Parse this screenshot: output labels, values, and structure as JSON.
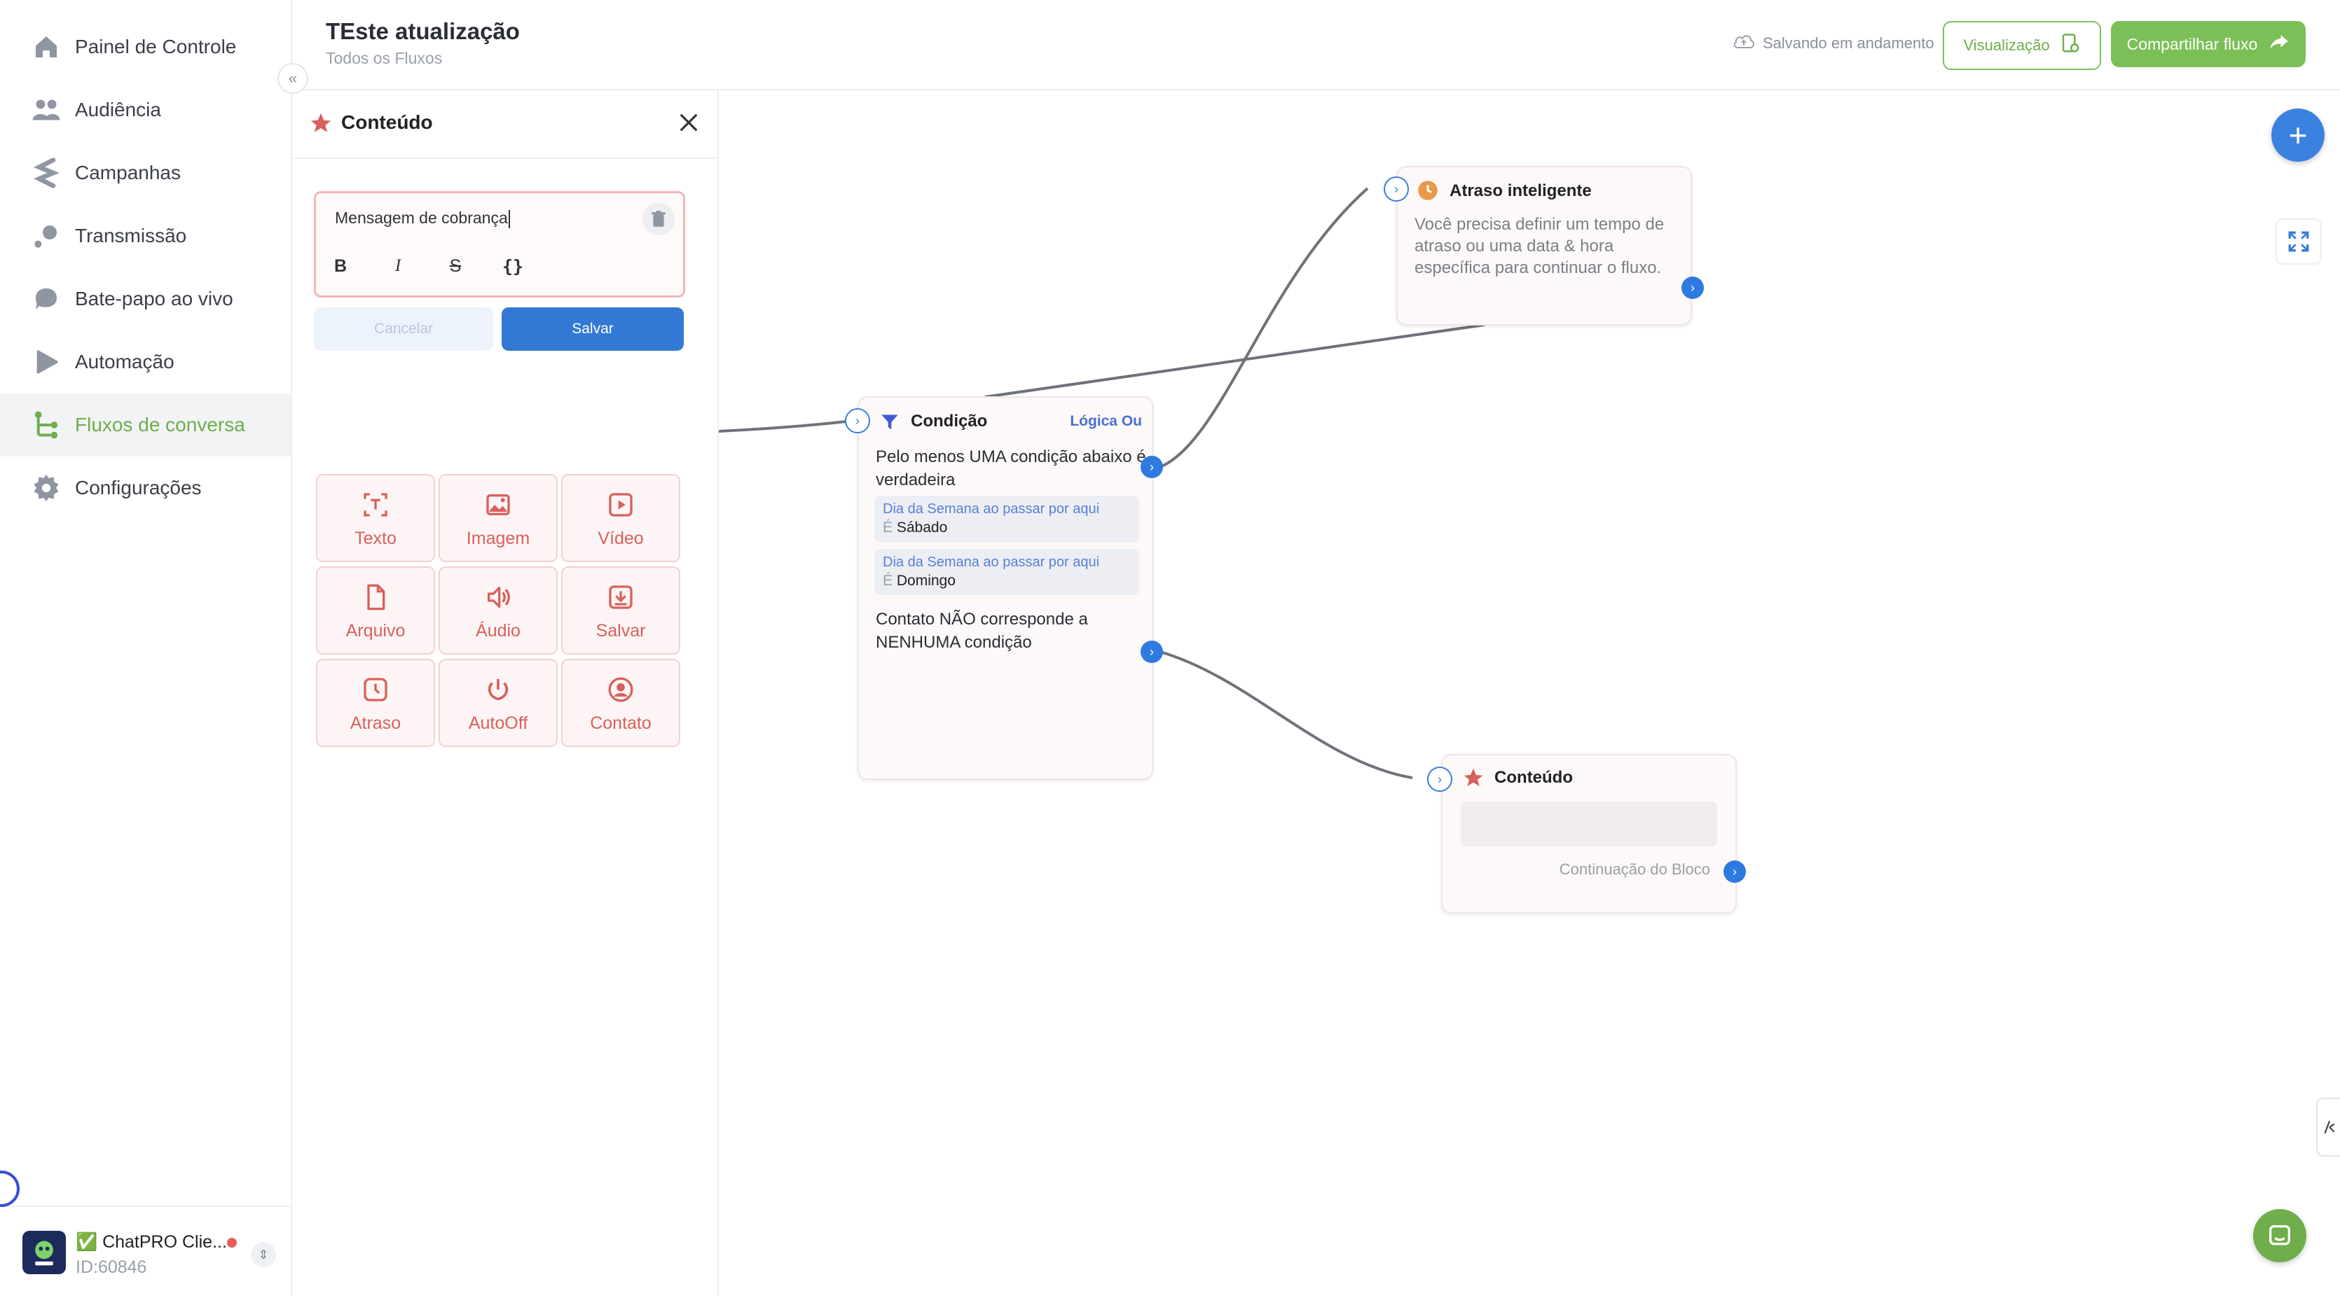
{
  "sidebar": {
    "items": [
      {
        "label": "Painel de Controle",
        "icon": "home-icon"
      },
      {
        "label": "Audiência",
        "icon": "users-icon"
      },
      {
        "label": "Campanhas",
        "icon": "campaign-icon"
      },
      {
        "label": "Transmissão",
        "icon": "broadcast-icon"
      },
      {
        "label": "Bate-papo ao vivo",
        "icon": "chat-bubble-icon"
      },
      {
        "label": "Automação",
        "icon": "play-icon"
      },
      {
        "label": "Fluxos de conversa",
        "icon": "flow-icon",
        "active": true
      },
      {
        "label": "Configurações",
        "icon": "gear-icon"
      }
    ],
    "account": {
      "name": "✅ ChatPRO Clie...",
      "id": "ID:60846"
    }
  },
  "header": {
    "title": "TEste atualização",
    "subtitle": "Todos os Fluxos",
    "saving_status": "Salvando em andamento",
    "preview_label": "Visualização",
    "share_label": "Compartilhar fluxo"
  },
  "panel": {
    "title": "Conteúdo",
    "editor": {
      "value": "Mensagem de cobrança",
      "format_buttons": [
        "B",
        "I",
        "S",
        "{}"
      ]
    },
    "cancel_label": "Cancelar",
    "save_label": "Salvar",
    "tiles": [
      {
        "label": "Texto",
        "icon": "text-icon"
      },
      {
        "label": "Imagem",
        "icon": "image-icon"
      },
      {
        "label": "Vídeo",
        "icon": "video-icon"
      },
      {
        "label": "Arquivo",
        "icon": "file-icon"
      },
      {
        "label": "Áudio",
        "icon": "audio-icon"
      },
      {
        "label": "Salvar",
        "icon": "download-icon"
      },
      {
        "label": "Atraso",
        "icon": "clock-icon"
      },
      {
        "label": "AutoOff",
        "icon": "power-icon"
      },
      {
        "label": "Contato",
        "icon": "contact-icon"
      }
    ]
  },
  "canvas": {
    "condition_node": {
      "title": "Condição",
      "logic": "Lógica Ou",
      "true_text": "Pelo menos UMA condição abaixo é verdadeira",
      "conditions": [
        {
          "field": "Dia da Semana ao passar por aqui",
          "operator": "É",
          "value": "Sábado"
        },
        {
          "field": "Dia da Semana ao passar por aqui",
          "operator": "É",
          "value": "Domingo"
        }
      ],
      "false_text": "Contato NÃO corresponde a NENHUMA condição"
    },
    "delay_node": {
      "title": "Atraso inteligente",
      "text": "Você precisa definir um tempo de atraso ou uma data & hora específica para continuar o fluxo."
    },
    "content_node": {
      "title": "Conteúdo",
      "continuation": "Continuação do Bloco"
    }
  },
  "colors": {
    "accent_green": "#6fae4a",
    "primary_blue": "#3379d4",
    "danger_red": "#d9605a"
  }
}
